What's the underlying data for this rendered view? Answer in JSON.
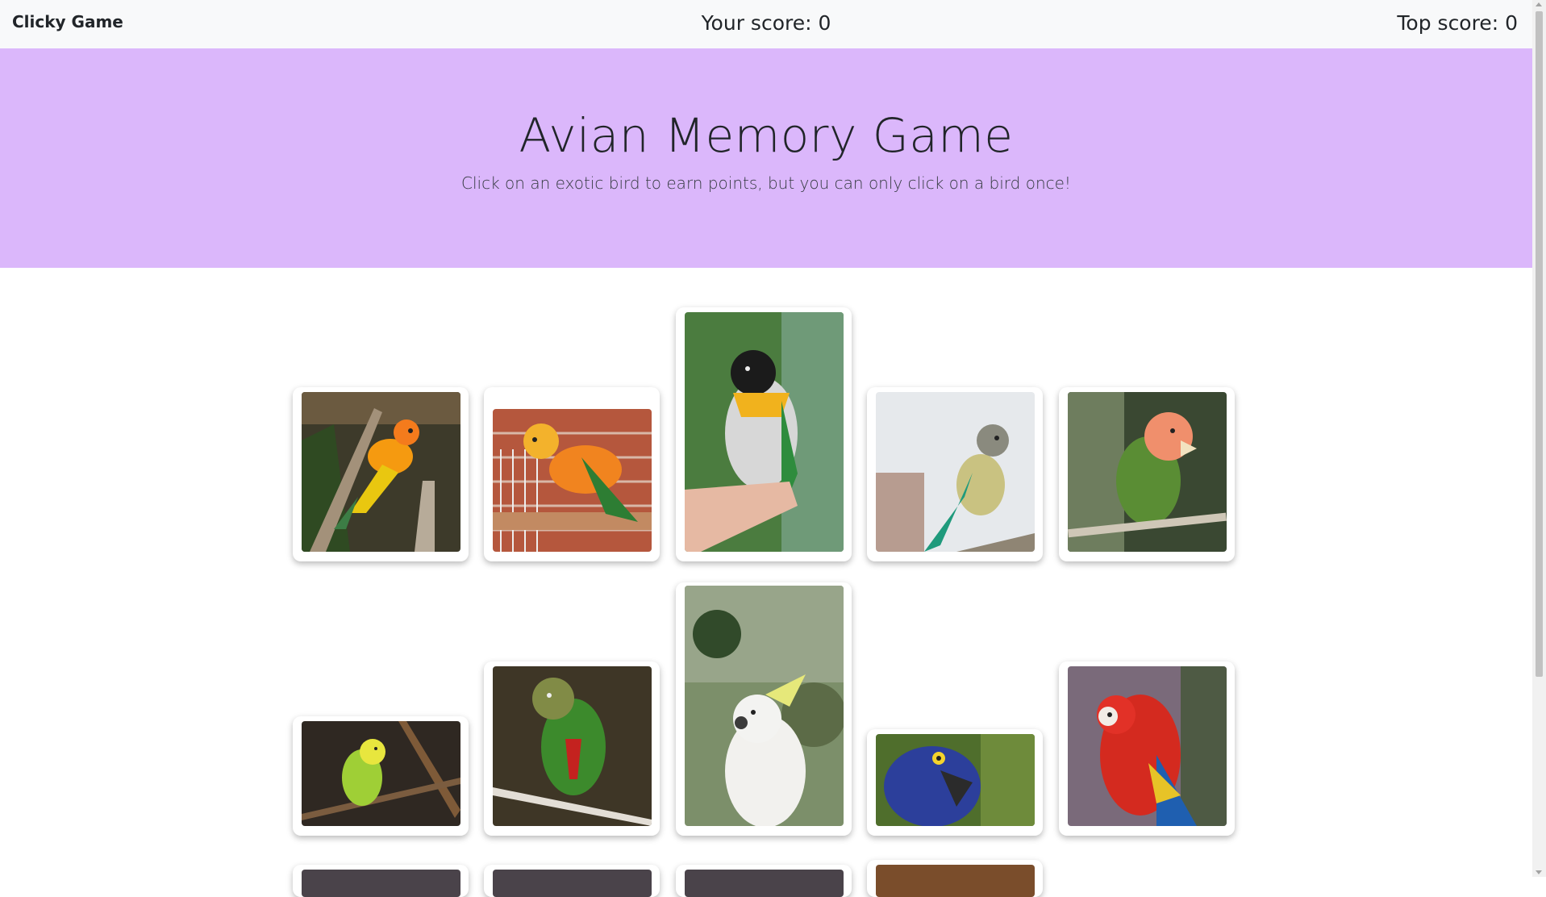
{
  "navbar": {
    "brand": "Clicky Game",
    "score_label": "Your score: 0",
    "top_score_label": "Top score: 0"
  },
  "header": {
    "title": "Avian Memory Game",
    "subtitle": "Click on an exotic bird to earn points, but you can only click on a bird once!"
  },
  "colors": {
    "jumbotron": "#dbb7fb",
    "navbar": "#f8f9fa"
  },
  "birds": [
    {
      "name": "sun-conure-icon"
    },
    {
      "name": "jenday-conure-icon"
    },
    {
      "name": "caique-icon"
    },
    {
      "name": "green-cheek-conure-icon"
    },
    {
      "name": "lovebird-icon"
    },
    {
      "name": "budgie-icon"
    },
    {
      "name": "crimson-bellied-conure-icon"
    },
    {
      "name": "cockatoo-icon"
    },
    {
      "name": "hyacinth-macaw-icon"
    },
    {
      "name": "scarlet-macaw-icon"
    },
    {
      "name": "bird-photo-icon"
    },
    {
      "name": "bird-photo-icon"
    },
    {
      "name": "bird-photo-icon"
    },
    {
      "name": "bird-photo-icon"
    }
  ]
}
